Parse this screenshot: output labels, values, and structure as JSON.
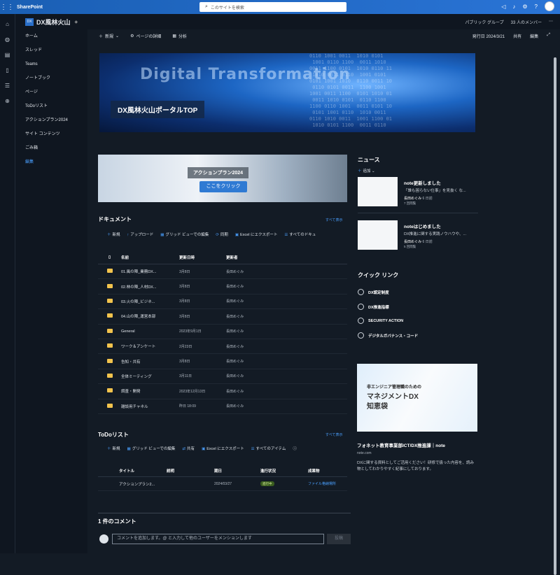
{
  "topbar": {
    "brand": "SharePoint",
    "search_placeholder": "このサイトを検索"
  },
  "site": {
    "logo": "DX",
    "title": "DX風林火山",
    "right": [
      "パブリック グループ",
      "33 人のメンバー",
      "⋯"
    ]
  },
  "nav": {
    "items": [
      "ホーム",
      "スレッド",
      "Teams",
      "ノートブック",
      "ページ",
      "ToDoリスト",
      "アクションプラン2024",
      "サイト コンテンツ",
      "ごみ箱",
      "編集"
    ]
  },
  "cmdbar": {
    "new": "新規",
    "page_details": "ページの詳細",
    "analytics": "分析",
    "published": "発行日 2024/3/21",
    "share": "共有",
    "edit": "編集"
  },
  "banner": {
    "big": "Digital Transformation",
    "tag": "DX風林火山ポータルTOP"
  },
  "plan": {
    "title": "アクションプラン2024",
    "button": "ここをクリック"
  },
  "documents": {
    "title": "ドキュメント",
    "see_all": "すべて表示",
    "toolbar": [
      "新規",
      "アップロード",
      "グリッド ビューでの編集",
      "同期",
      "Excel にエクスポート",
      "すべてのドキュ"
    ],
    "headers": [
      "名前",
      "更新日時",
      "更新者"
    ],
    "rows": [
      {
        "name": "01.風の陣_業務DX...",
        "date": "3月8日",
        "by": "長田めぐみ"
      },
      {
        "name": "02.林の陣_人材DX...",
        "date": "3月8日",
        "by": "長田めぐみ"
      },
      {
        "name": "03.火の陣_ビジネ...",
        "date": "3月8日",
        "by": "長田めぐみ"
      },
      {
        "name": "04.山の陣_運営本部",
        "date": "3月8日",
        "by": "長田めぐみ"
      },
      {
        "name": "General",
        "date": "2023年9月1日",
        "by": "長田めぐみ"
      },
      {
        "name": "ワーク＆アンケート",
        "date": "2月23日",
        "by": "長田めぐみ"
      },
      {
        "name": "告知・共有",
        "date": "3月8日",
        "by": "長田めぐみ"
      },
      {
        "name": "全体ミーティング",
        "date": "3月11日",
        "by": "長田めぐみ"
      },
      {
        "name": "調査・開発",
        "date": "2023年12月13日",
        "by": "長田めぐみ"
      },
      {
        "name": "雑談用チャネル",
        "date": "昨日 18:09",
        "by": "長田めぐみ"
      }
    ]
  },
  "todo": {
    "title": "ToDoリスト",
    "see_all": "すべて表示",
    "toolbar": [
      "新規",
      "グリッド ビューでの編集",
      "共有",
      "Excel にエクスポート",
      "すべてのアイテム"
    ],
    "headers": [
      "タイトル",
      "説明",
      "期日",
      "進行状況",
      "成果物"
    ],
    "rows": [
      {
        "title": "アクションプラン2...",
        "desc": "",
        "due": "2024/03/27",
        "status": "進行中",
        "link": "ファイル格納場所"
      }
    ]
  },
  "comments": {
    "title": "1 件のコメント",
    "placeholder": "コメントを追加します。@ と入力して他のユーザーをメンションします",
    "post": "投稿"
  },
  "news": {
    "title": "ニュース",
    "add": "追加",
    "items": [
      {
        "title": "note更新しました",
        "desc": "「誰も困らない仕事」を見抜く な...",
        "author": "長田めぐみ",
        "when": "6 日前",
        "views": "7 回閲覧"
      },
      {
        "title": "noteはじめました",
        "desc": "DX推進に関する実践ノウハウや、...",
        "author": "長田めぐみ",
        "when": "6 日前",
        "views": "5 回閲覧"
      }
    ]
  },
  "quicklinks": {
    "title": "クイック リンク",
    "items": [
      "DX認定制度",
      "DX推進指標",
      "SECURITY ACTION",
      "デジタルガバナンス・コード"
    ]
  },
  "note": {
    "img_line1": "非エンジニア管理職のための",
    "img_line2": "マネジメントDX",
    "img_line3": "知恵袋",
    "title": "フォネット教育事業部ICT/DX推進課｜note",
    "source": "note.com",
    "desc": "DXに関する資料としてご活用ください！研修で扱った内容を、読み物としてわかりやすく紀事にしております。"
  }
}
